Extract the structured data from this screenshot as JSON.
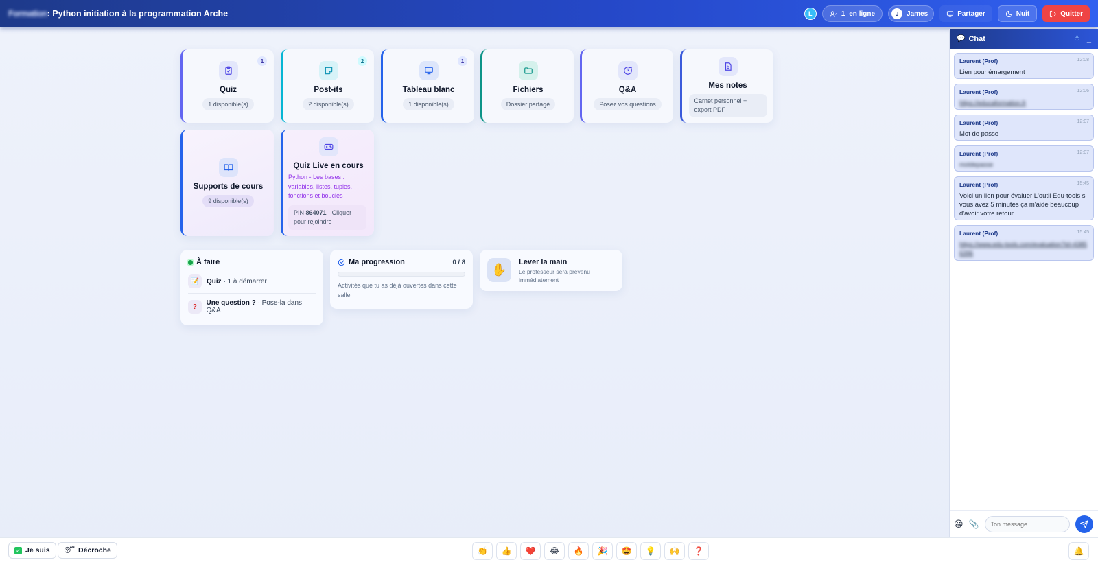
{
  "header": {
    "title_blurred": "Formation",
    "title": ": Python initiation à la programmation Arche",
    "user_badge": "L",
    "online_count": "1",
    "online_label": "en ligne",
    "user_initial": "J",
    "user_name": "James",
    "share_label": "Partager",
    "night_label": "Nuit",
    "quit_label": "Quitter"
  },
  "cards": [
    {
      "title": "Quiz",
      "chip": "1 disponible(s)",
      "count": "1",
      "icon": "clipboard-check-icon"
    },
    {
      "title": "Post-its",
      "chip": "2 disponible(s)",
      "count": "2",
      "icon": "sticky-note-icon"
    },
    {
      "title": "Tableau blanc",
      "chip": "1 disponible(s)",
      "count": "1",
      "icon": "monitor-icon"
    },
    {
      "title": "Fichiers",
      "chip": "Dossier partagé",
      "icon": "folder-icon"
    },
    {
      "title": "Q&A",
      "chip": "Posez vos questions",
      "icon": "message-question-icon"
    },
    {
      "title": "Mes notes",
      "chip": "Carnet personnel + export PDF",
      "icon": "file-text-icon"
    },
    {
      "title": "Supports de cours",
      "chip": "9 disponible(s)",
      "icon": "book-open-icon"
    },
    {
      "title": "Quiz Live en cours",
      "desc": "Python - Les bases : variables, listes, tuples, fonctions et boucles",
      "pin_label": "PIN",
      "pin": "864071",
      "pin_suffix": "· Cliquer pour rejoindre",
      "icon": "gamepad-icon"
    }
  ],
  "todo": {
    "title": "À faire",
    "items": [
      {
        "strong": "Quiz",
        "rest": "· 1 à démarrer"
      },
      {
        "strong": "Une question ?",
        "rest": "· Pose-la dans Q&A"
      }
    ]
  },
  "progress": {
    "title": "Ma progression",
    "value": "0 / 8",
    "fraction": 0,
    "desc": "Activités que tu as déjà ouvertes dans cette salle"
  },
  "raise_hand": {
    "title": "Lever la main",
    "desc": "Le professeur sera prévenu immédiatement"
  },
  "chat": {
    "title": "Chat",
    "placeholder": "Ton message...",
    "messages": [
      {
        "author": "Laurent (Prof)",
        "time": "12:08",
        "body": "Lien pour émargement"
      },
      {
        "author": "Laurent (Prof)",
        "time": "12:06",
        "body": "https://educaformation.fr"
      },
      {
        "author": "Laurent (Prof)",
        "time": "12:07",
        "body": "Mot de passe"
      },
      {
        "author": "Laurent (Prof)",
        "time": "12:07",
        "body": "motdepasse"
      },
      {
        "author": "Laurent (Prof)",
        "time": "15:45",
        "body": "Voici un lien pour évaluer L'outil Edu-tools si vous avez 5 minutes ça m'aide beaucoup d'avoir votre retour"
      },
      {
        "author": "Laurent (Prof)",
        "time": "15:45",
        "body": "https://www.edu-tools.com/evaluation?id=43856396"
      }
    ]
  },
  "bottom": {
    "present_label": "Je suis",
    "away_label": "Décroche",
    "reactions": [
      "👏",
      "👍",
      "❤️",
      "😂",
      "🔥",
      "🎉",
      "🤩",
      "💡",
      "🙌",
      "❓"
    ],
    "bell": "🔔"
  }
}
